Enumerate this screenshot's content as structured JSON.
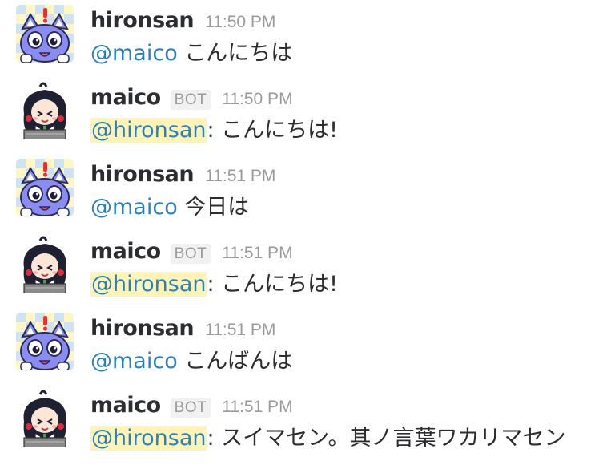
{
  "messages": [
    {
      "user": "hironsan",
      "is_bot": false,
      "badge": "",
      "time": "11:50 PM",
      "mention": "@maico",
      "mention_self": false,
      "separator": " ",
      "text": "こんにちは",
      "avatar_icon": "cat-avatar-icon"
    },
    {
      "user": "maico",
      "is_bot": true,
      "badge": "BOT",
      "time": "11:50 PM",
      "mention": "@hironsan",
      "mention_self": true,
      "separator": ": ",
      "text": "こんにちは!",
      "avatar_icon": "girl-avatar-icon"
    },
    {
      "user": "hironsan",
      "is_bot": false,
      "badge": "",
      "time": "11:51 PM",
      "mention": "@maico",
      "mention_self": false,
      "separator": " ",
      "text": "今日は",
      "avatar_icon": "cat-avatar-icon"
    },
    {
      "user": "maico",
      "is_bot": true,
      "badge": "BOT",
      "time": "11:51 PM",
      "mention": "@hironsan",
      "mention_self": true,
      "separator": ": ",
      "text": "こんにちは!",
      "avatar_icon": "girl-avatar-icon"
    },
    {
      "user": "hironsan",
      "is_bot": false,
      "badge": "",
      "time": "11:51 PM",
      "mention": "@maico",
      "mention_self": false,
      "separator": " ",
      "text": "こんばんは",
      "avatar_icon": "cat-avatar-icon"
    },
    {
      "user": "maico",
      "is_bot": true,
      "badge": "BOT",
      "time": "11:51 PM",
      "mention": "@hironsan",
      "mention_self": true,
      "separator": ": ",
      "text": "スイマセン。其ノ言葉ワカリマセン",
      "avatar_icon": "girl-avatar-icon"
    }
  ],
  "colors": {
    "mention": "#2a80b9",
    "mention_self_bg": "#fff3b8",
    "text": "#2c2d30",
    "muted": "#9a9a9d"
  }
}
